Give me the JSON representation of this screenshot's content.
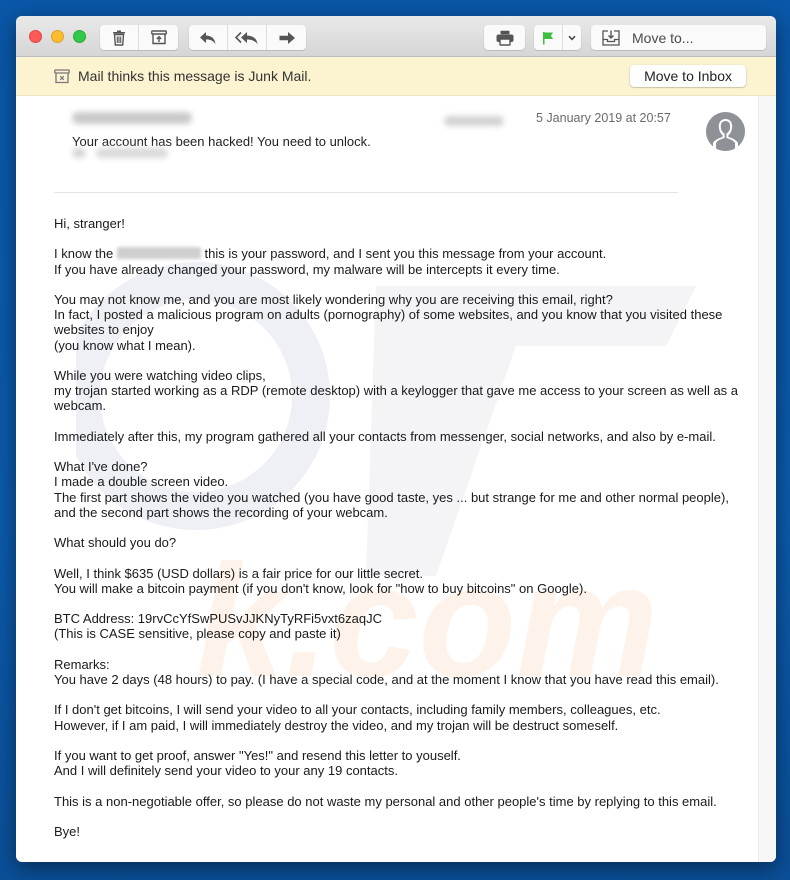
{
  "window": {
    "toolbar": {
      "delete_icon": "trash-icon",
      "archive_icon": "archive-icon",
      "reply_icon": "reply-icon",
      "reply_all_icon": "reply-all-icon",
      "forward_icon": "forward-icon",
      "print_icon": "printer-icon",
      "flag_icon": "flag-icon",
      "flag_color": "#3fbf3f",
      "flag_menu_icon": "chevron-down-icon",
      "move_icon": "move-tray-icon",
      "move_label": "Move to..."
    },
    "junk_banner": {
      "icon": "junk-bin-icon",
      "text": "Mail thinks this message is Junk Mail.",
      "button_label": "Move to Inbox"
    }
  },
  "message": {
    "subject": "Your account has been hacked! You need to unlock.",
    "date": "5 January 2019 at 20:57",
    "avatar_icon": "person-silhouette-icon",
    "body": {
      "greeting": "Hi, stranger!",
      "p1_before": "I know the ",
      "p1_after": " this is your password, and I sent you this message from your account.\nIf you have already changed your password, my malware will be intercepts it every time.",
      "p2": "You may not know me, and you are most likely wondering why you are receiving this email, right?\nIn fact, I posted a malicious program on adults (pornography) of some websites, and you know that you visited these websites to enjoy\n(you know what I mean).",
      "p3": "While you were watching video clips,\nmy trojan started working as a RDP (remote desktop) with a keylogger that gave me access to your screen as well as a webcam.",
      "p4": "Immediately after this, my program gathered all your contacts from messenger, social networks, and also by e-mail.",
      "p5": "What I've done?\nI made a double screen video.\nThe first part shows the video you watched (you have good taste, yes ... but strange for me and other normal people),\nand the second part shows the recording of your webcam.",
      "p6": "What should you do?",
      "p7": "Well, I think $635 (USD dollars) is a fair price for our little secret.\nYou will make a bitcoin payment (if you don't know, look for \"how to buy bitcoins\" on Google).",
      "p8": "BTC Address: 19rvCcYfSwPUSvJJKNyTyRFi5vxt6zaqJC\n(This is CASE sensitive, please copy and paste it)",
      "p9": "Remarks:\nYou have 2 days (48 hours) to pay. (I have a special code, and at the moment I know that you have read this email).",
      "p10": "If I don't get bitcoins, I will send your video to all your contacts, including family members, colleagues, etc.\nHowever, if I am paid, I will immediately destroy the video, and my trojan will be destruct someself.",
      "p11": "If you want to get proof, answer \"Yes!\" and resend this letter to youself.\nAnd I will definitely send your video to your any 19 contacts.",
      "p12": "This is a non-negotiable offer, so please do not waste my personal and other people's time by replying to this email.",
      "closing": "Bye!"
    }
  }
}
